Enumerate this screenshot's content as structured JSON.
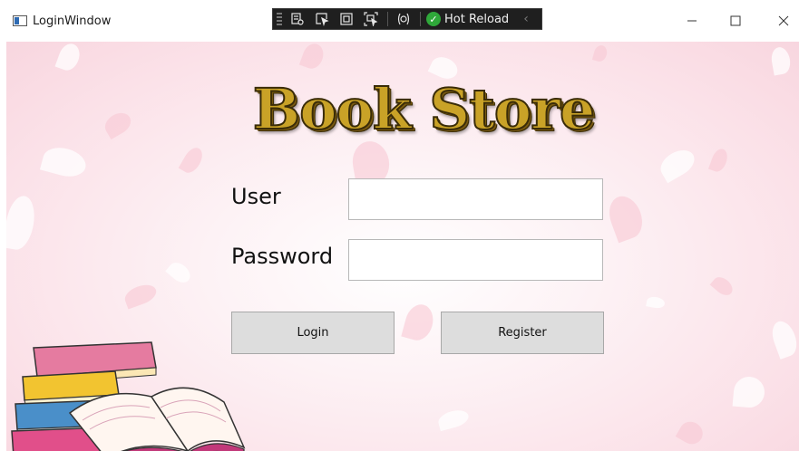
{
  "window": {
    "title": "LoginWindow"
  },
  "devtools": {
    "hot_reload_label": "Hot Reload",
    "tools": [
      "live-visual-tree-icon",
      "select-element-icon",
      "display-layout-adorners-icon",
      "track-focus-icon",
      "binding-failures-icon"
    ]
  },
  "app": {
    "title": "Book Store",
    "user_label": "User",
    "password_label": "Password",
    "user_value": "",
    "password_value": "",
    "login_label": "Login",
    "register_label": "Register"
  },
  "colors": {
    "background_pink": "#fbe1e8",
    "title_gold": "#c9a227",
    "button_gray": "#dddddd",
    "devbar_dark": "#1f1f1f",
    "hot_reload_green": "#2fa83a"
  }
}
